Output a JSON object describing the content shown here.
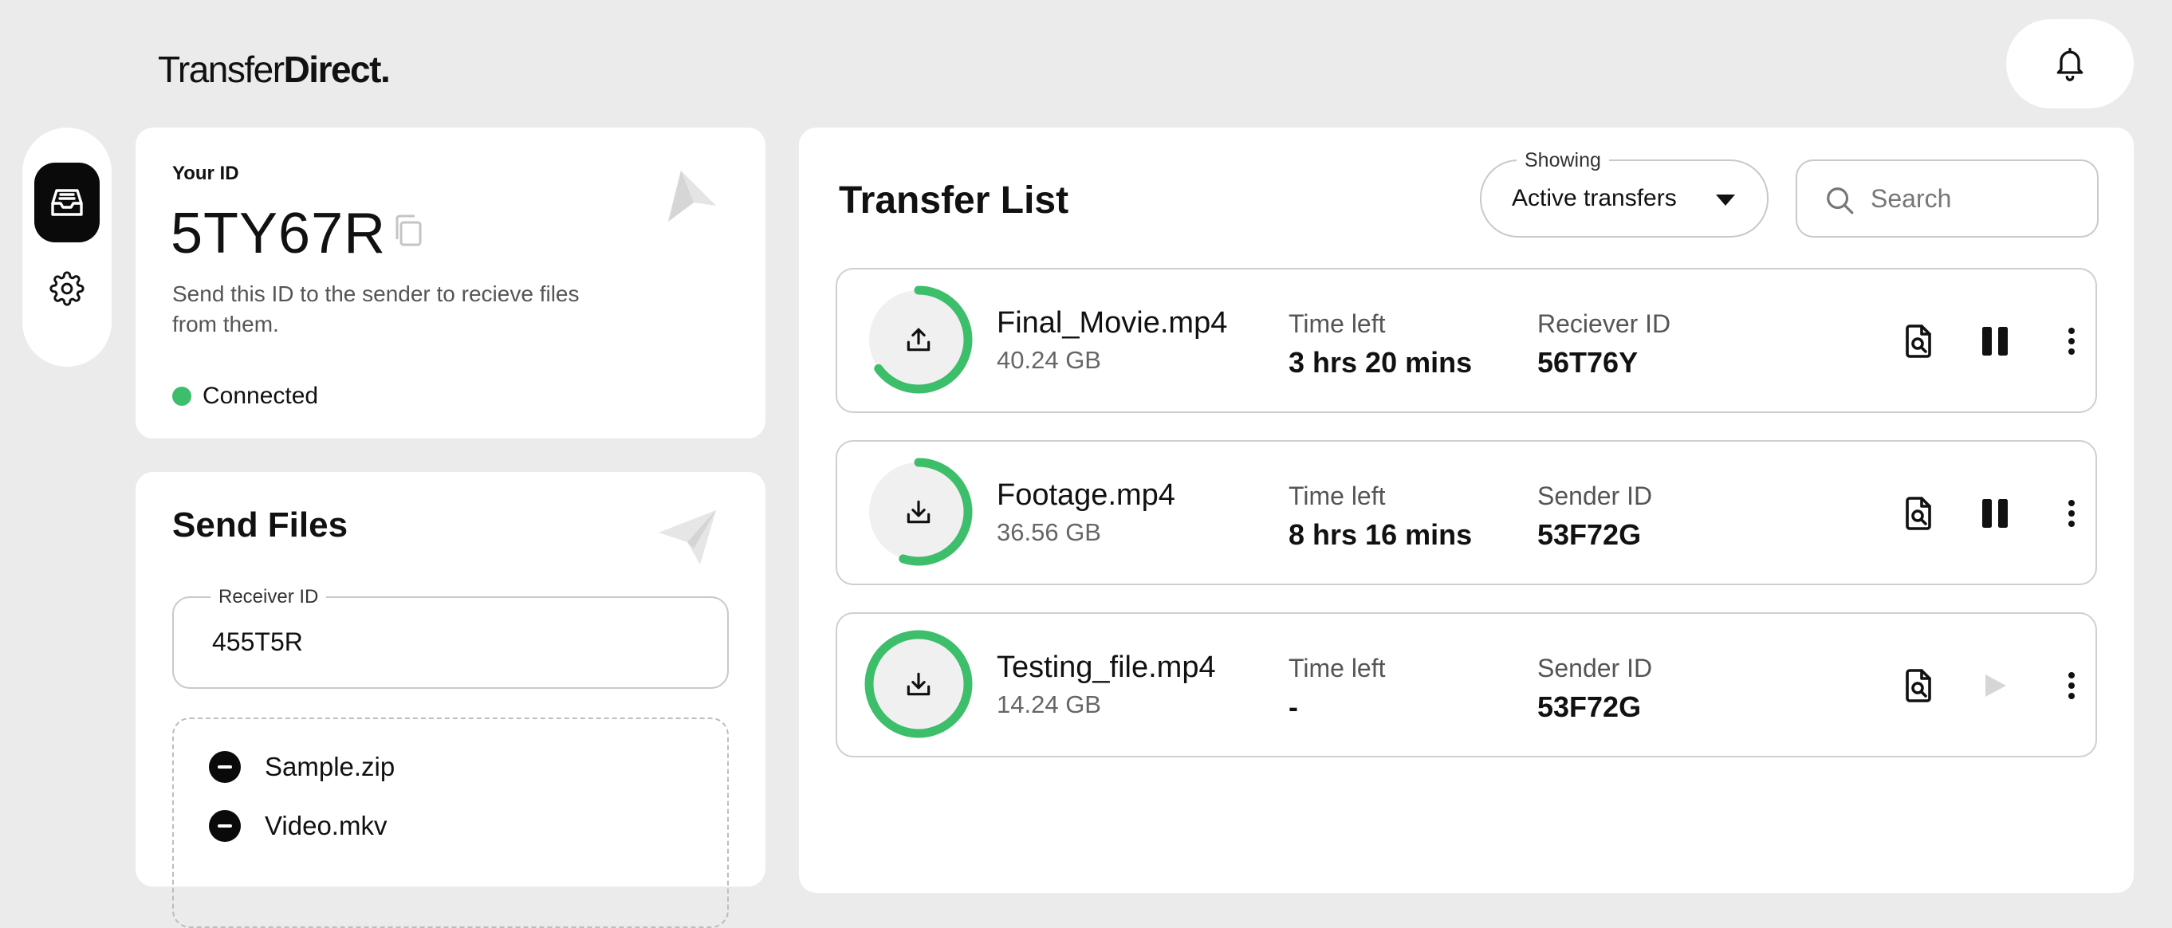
{
  "brand": {
    "part1": "Transfer",
    "part2": "Direct."
  },
  "header": {
    "bell_icon": "bell-icon"
  },
  "sidebar": {
    "items": [
      {
        "icon": "inbox-icon",
        "active": true
      },
      {
        "icon": "gear-icon",
        "active": false
      }
    ]
  },
  "id_card": {
    "label": "Your ID",
    "value": "5TY67R",
    "description": "Send this ID to the sender to recieve files from them.",
    "status": "Connected",
    "status_color": "#3dbe6b"
  },
  "send_files": {
    "title": "Send Files",
    "receiver_label": "Receiver ID",
    "receiver_value": "455T5R",
    "files": [
      {
        "name": "Sample.zip"
      },
      {
        "name": "Video.mkv"
      }
    ]
  },
  "transfer_list": {
    "title": "Transfer List",
    "filter_label": "Showing",
    "filter_value": "Active transfers",
    "search_placeholder": "Search",
    "accent_color": "#3dbe6b",
    "rows": [
      {
        "name": "Final_Movie.mp4",
        "size": "40.24 GB",
        "time_label": "Time left",
        "time_value": "3 hrs 20 mins",
        "peer_label": "Reciever ID",
        "peer_value": "56T76Y",
        "direction": "upload",
        "progress": 0.65,
        "control": "pause"
      },
      {
        "name": "Footage.mp4",
        "size": "36.56 GB",
        "time_label": "Time left",
        "time_value": "8 hrs 16 mins",
        "peer_label": "Sender ID",
        "peer_value": "53F72G",
        "direction": "download",
        "progress": 0.55,
        "control": "pause"
      },
      {
        "name": "Testing_file.mp4",
        "size": "14.24 GB",
        "time_label": "Time left",
        "time_value": "-",
        "peer_label": "Sender ID",
        "peer_value": "53F72G",
        "direction": "download",
        "progress": 1.0,
        "control": "play"
      }
    ]
  }
}
